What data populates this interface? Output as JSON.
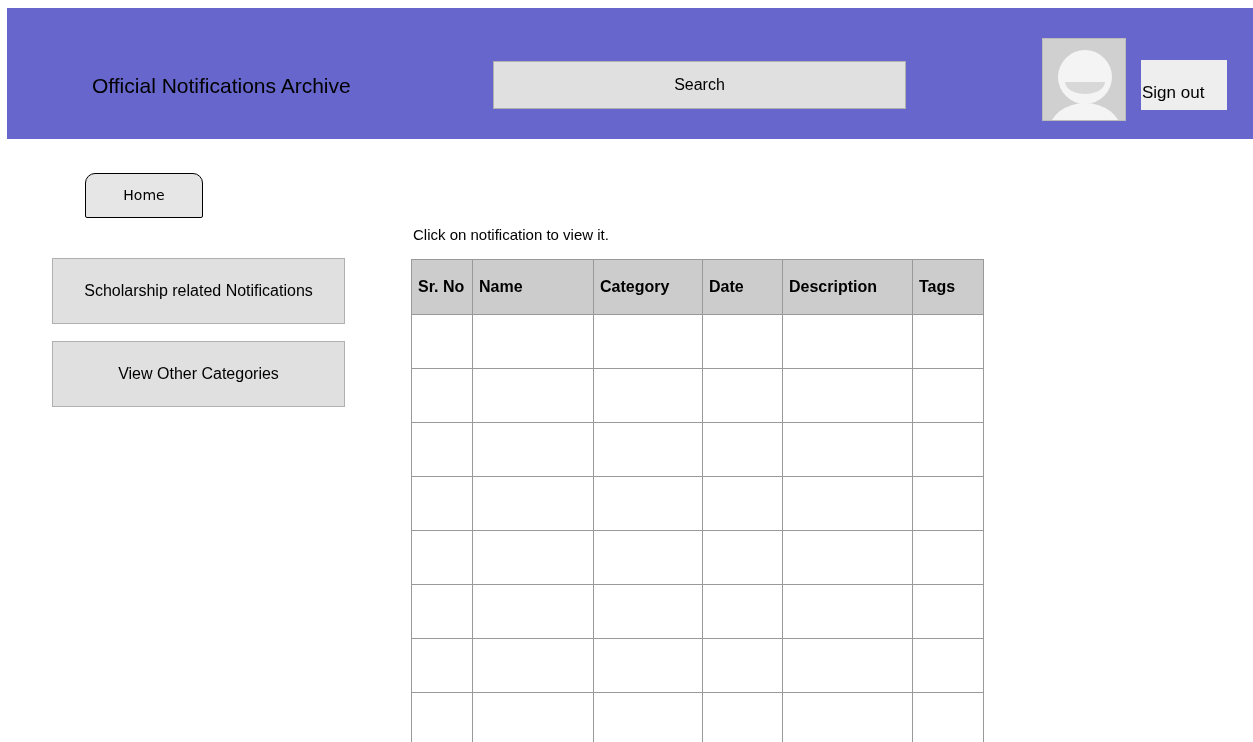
{
  "header": {
    "title": "Official Notifications Archive",
    "search": {
      "label": "Search"
    },
    "sign_out": "Sign out"
  },
  "home_button": "Home",
  "sidebar": {
    "items": [
      {
        "label": "Scholarship related Notifications"
      },
      {
        "label": "View Other Categories"
      }
    ]
  },
  "hint": "Click on notification to view it.",
  "table": {
    "columns": [
      "Sr. No",
      "Name",
      "Category",
      "Date",
      "Description",
      "Tags"
    ]
  }
}
